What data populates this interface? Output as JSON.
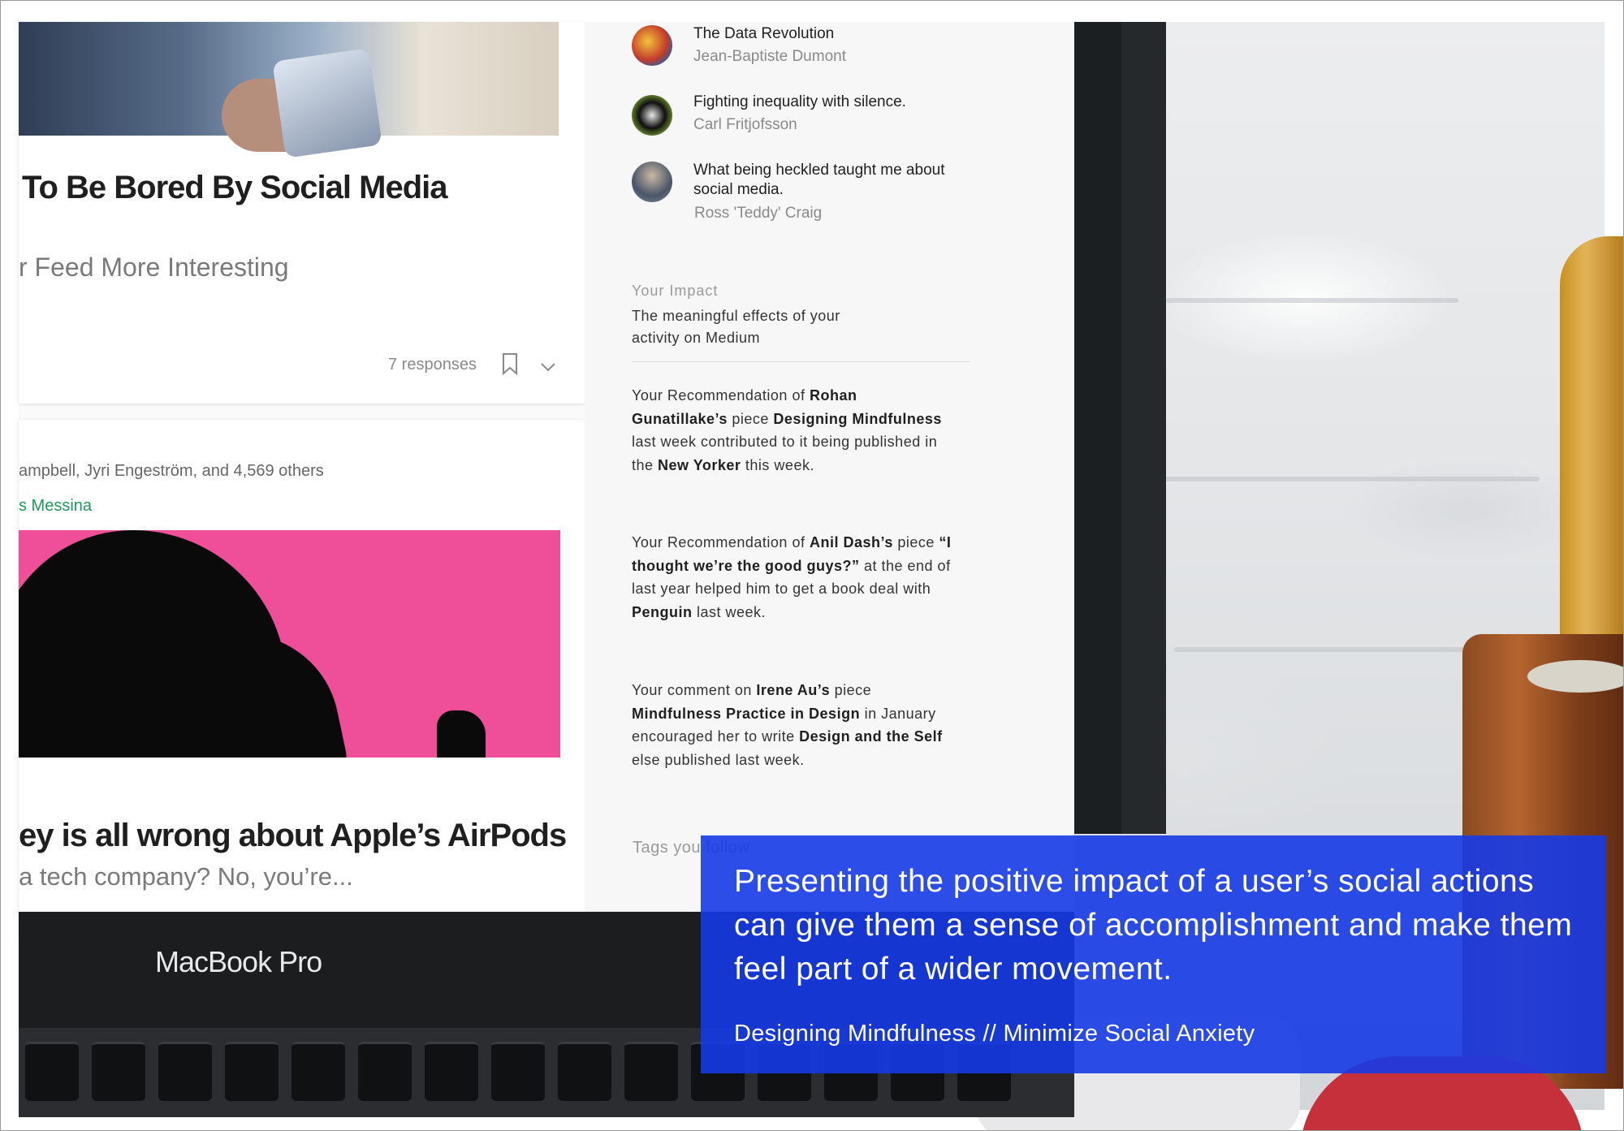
{
  "feed": {
    "card1": {
      "headline": "To Be Bored By Social Media",
      "subline": "r Feed More Interesting",
      "responses": "7 responses"
    },
    "card2": {
      "recommended_by": "ampbell, Jyri Engeström, and 4,569 others",
      "author": "s Messina",
      "headline": "ey is all wrong about Apple’s AirPods",
      "subline": "a tech company? No, you’re..."
    }
  },
  "sidebar": {
    "recommended": [
      {
        "title": "The Data Revolution",
        "author": "Jean-Baptiste Dumont"
      },
      {
        "title": "Fighting inequality with silence.",
        "author": "Carl Fritjofsson"
      },
      {
        "title": "What being heckled taught me about social media.",
        "author": "Ross 'Teddy' Craig"
      }
    ],
    "impact": {
      "label": "Your Impact",
      "desc": "The meaningful effects of your activity on Medium",
      "items": [
        {
          "p1": "Your Recommendation of ",
          "b1": "Rohan Gunatillake’s",
          "p2": " piece ",
          "b2": "Designing Mindfulness",
          "p3": " last week contributed to it being published in the ",
          "b3": "New Yorker",
          "p4": " this week."
        },
        {
          "p1": "Your Recommendation of ",
          "b1": "Anil Dash’s",
          "p2": " piece ",
          "b2": "“I thought we’re the good guys?”",
          "p3": " at the end of last year helped him to get a book deal with ",
          "b3": "Penguin",
          "p4": " last week."
        },
        {
          "p1": "Your comment on ",
          "b1": "Irene Au’s",
          "p2": " piece ",
          "b2": "Mindfulness Practice in Design",
          "p3": " in January encouraged her to write ",
          "b3": "Design and the Self",
          "p4": " else published last week."
        }
      ]
    },
    "tags_label": "Tags you follow"
  },
  "laptop": {
    "brand": "MacBook Pro"
  },
  "overlay": {
    "quote": "Presenting the positive impact of a user’s social actions can give them a sense of accomplishment and make them feel part of a wider movement.",
    "source": "Designing Mindfulness // Minimize Social Anxiety"
  },
  "icons": {
    "bookmark": "bookmark-icon",
    "chevron": "chevron-down-icon"
  },
  "colors": {
    "overlay_blue": "#163ae6",
    "author_green": "#1d9a5b",
    "pink": "#ef4e98"
  }
}
